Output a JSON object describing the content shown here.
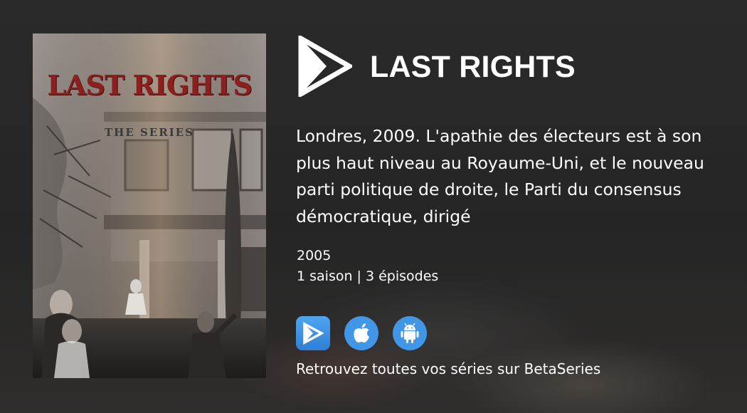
{
  "poster": {
    "title_text": "LAST RIGHTS",
    "subtitle_text": "THE SERIES"
  },
  "show": {
    "title": "LAST RIGHTS",
    "synopsis": "Londres, 2009. L'apathie des électeurs est à son plus haut niveau au Royaume-Uni, et le nouveau parti politique de droite, le Parti du consensus démocratique, dirigé",
    "year": "2005",
    "seasons_episodes": "1 saison | 3 épisodes"
  },
  "apps": [
    {
      "name": "BetaSeries",
      "icon": "betaseries-play-icon"
    },
    {
      "name": "iOS",
      "icon": "apple-icon"
    },
    {
      "name": "Android",
      "icon": "android-icon"
    }
  ],
  "footer": {
    "tagline": "Retrouvez toutes vos séries sur BetaSeries"
  },
  "colors": {
    "background": "#262626",
    "accent_blue": "#4197e6",
    "text": "#ffffff",
    "poster_title_red": "#8e1f1f"
  }
}
